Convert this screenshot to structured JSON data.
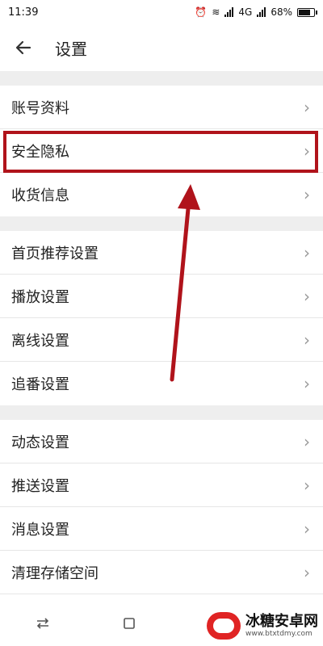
{
  "status_bar": {
    "time": "11:39",
    "network": "4G",
    "battery_percent": "68%",
    "battery_level": 0.68
  },
  "header": {
    "title": "设置",
    "back_icon": "arrow-left-icon"
  },
  "settings": {
    "groups": [
      {
        "items": [
          {
            "label": "账号资料"
          },
          {
            "label": "安全隐私"
          },
          {
            "label": "收货信息"
          }
        ]
      },
      {
        "items": [
          {
            "label": "首页推荐设置"
          },
          {
            "label": "播放设置"
          },
          {
            "label": "离线设置"
          },
          {
            "label": "追番设置"
          }
        ]
      },
      {
        "items": [
          {
            "label": "动态设置"
          },
          {
            "label": "推送设置"
          },
          {
            "label": "消息设置"
          },
          {
            "label": "清理存储空间"
          }
        ]
      }
    ]
  },
  "annotation": {
    "highlight_color": "#b0131b"
  },
  "watermark": {
    "title": "冰糖安卓网",
    "url": "www.btxtdmy.com"
  },
  "nav_bar": {
    "buttons": [
      "switch-icon",
      "recent-apps-icon"
    ]
  }
}
